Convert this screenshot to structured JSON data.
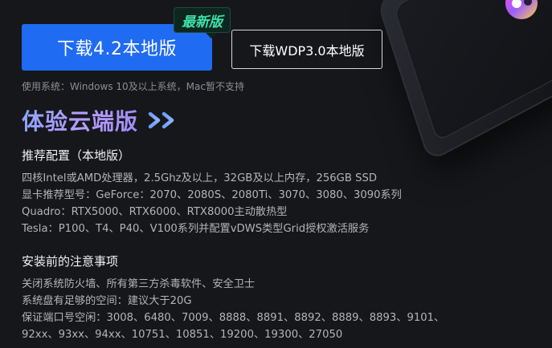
{
  "download": {
    "primary_label": "下载4.2本地版",
    "badge": "最新版",
    "secondary_label": "下载WDP3.0本地版",
    "system_requirements": "使用系统：Windows 10及以上系统，Mac暂不支持"
  },
  "cloud": {
    "label": "体验云端版"
  },
  "recommended": {
    "title": "推荐配置（本地版）",
    "lines": [
      "四核Intel或AMD处理器，2.5Ghz及以上，32GB及以上内存，256GB SSD",
      "显卡推荐型号：GeForce：2070、2080S、2080Ti、3070、3080、3090系列",
      "Quadro：RTX5000、RTX6000、RTX8000主动散热型",
      "Tesla：P100、T4、P40、V100系列并配置vDWS类型Grid授权激活服务"
    ]
  },
  "notes": {
    "title": "安装前的注意事项",
    "lines": [
      "关闭系统防火墙、所有第三方杀毒软件、安全卫士",
      "系统盘有足够的空间：建议大于20G",
      "保证端口号空闲：3008、6480、7009、8888、8891、8892、8889、8893、9101、",
      "92xx、93xx、94xx、10751、10851、19200、19300、27050"
    ]
  },
  "colors": {
    "background": "#16171b",
    "primary_button": "#1f6bf2",
    "badge_text": "#3fe0a8",
    "cloud_gradient_start": "#8fa3ff",
    "cloud_gradient_end": "#9f8cf5"
  },
  "icons": {
    "chevrons": "double-chevron-right-icon",
    "device": "device-illustration",
    "logo": "app-logo-icon"
  }
}
